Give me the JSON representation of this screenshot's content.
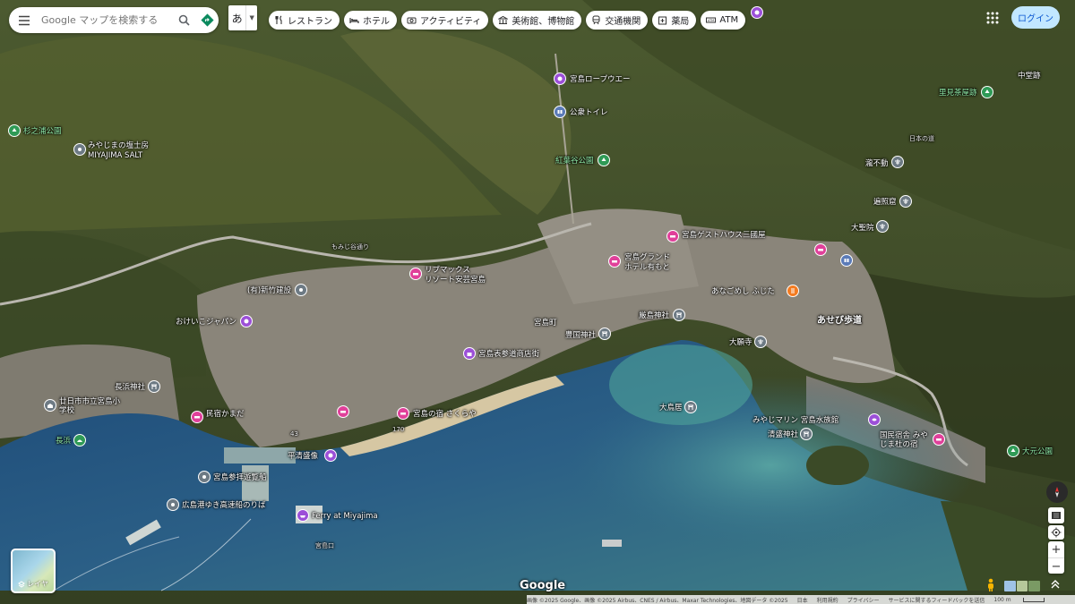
{
  "search": {
    "placeholder": "Google マップを検索する"
  },
  "ime": {
    "char": "あ"
  },
  "chips": [
    {
      "icon": "restaurant-icon",
      "label": "レストラン"
    },
    {
      "icon": "hotel-icon",
      "label": "ホテル"
    },
    {
      "icon": "camera-icon",
      "label": "アクティビティ"
    },
    {
      "icon": "museum-icon",
      "label": "美術館、博物館"
    },
    {
      "icon": "transit-icon",
      "label": "交通機関"
    },
    {
      "icon": "pharmacy-icon",
      "label": "薬局"
    },
    {
      "icon": "atm-icon",
      "label": "ATM"
    }
  ],
  "login_label": "ログイン",
  "places": [
    {
      "name": "宮島ロープウエー",
      "pin": "purple"
    },
    {
      "name": "公衆トイレ",
      "pin": "blue"
    },
    {
      "name": "紅葉谷公園",
      "pin": "green"
    },
    {
      "name": "中堂跡",
      "pin": "none"
    },
    {
      "name": "里見茶屋跡",
      "pin": "green"
    },
    {
      "name": "杉之浦公園",
      "pin": "green"
    },
    {
      "name": "みやじまの塩士房",
      "pin": "gray"
    },
    {
      "name": "MIYAJIMA SALT",
      "pin": "none"
    },
    {
      "name": "瀧不動",
      "pin": "gray"
    },
    {
      "name": "遍照窟",
      "pin": "gray"
    },
    {
      "name": "大聖院",
      "pin": "gray"
    },
    {
      "name": "宮島ゲストハウス三國屋",
      "pin": "pink"
    },
    {
      "name": "宮島グランド",
      "pin": "pink"
    },
    {
      "name": "ホテル有もと",
      "pin": "none"
    },
    {
      "name": "リブマックス",
      "pin": "pink"
    },
    {
      "name": "リゾート安芸宮島",
      "pin": "none"
    },
    {
      "name": "(有)新竹建設",
      "pin": "gray"
    },
    {
      "name": "おけいこジャパン",
      "pin": "purple"
    },
    {
      "name": "宮島町",
      "pin": "none"
    },
    {
      "name": "豊国神社",
      "pin": "gray"
    },
    {
      "name": "厳島神社",
      "pin": "gray"
    },
    {
      "name": "あなごめし ふじた",
      "pin": "orange"
    },
    {
      "name": "大願寺",
      "pin": "gray"
    },
    {
      "name": "あせび歩道",
      "pin": "none"
    },
    {
      "name": "宮島表参道商店街",
      "pin": "purple"
    },
    {
      "name": "長浜神社",
      "pin": "gray"
    },
    {
      "name": "廿日市市立宮島小学校",
      "pin": "gray"
    },
    {
      "name": "長浜",
      "pin": "green"
    },
    {
      "name": "民宿かまだ",
      "pin": "pink"
    },
    {
      "name": "宮島の宿 さくらや",
      "pin": "pink"
    },
    {
      "name": "大鳥居",
      "pin": "gray"
    },
    {
      "name": "みやじマリン 宮島水族館",
      "pin": "purple"
    },
    {
      "name": "清盛神社",
      "pin": "gray"
    },
    {
      "name": "国民宿舎 みやじま杜の宿",
      "pin": "pink"
    },
    {
      "name": "大元公園",
      "pin": "green"
    },
    {
      "name": "平清盛像",
      "pin": "purple"
    },
    {
      "name": "宮島参拝遊覧船",
      "pin": "gray"
    },
    {
      "name": "広島港ゆき高速船のりば",
      "pin": "gray"
    },
    {
      "name": "Ferry at Miyajima",
      "pin": "purple"
    }
  ],
  "road_labels": [
    "もみじ谷通り",
    "日本の道",
    "43",
    "170",
    "宮島口"
  ],
  "layers_label": "レイヤ",
  "google_logo": "Google",
  "footer": {
    "attribution": "画像 ©2025 Google、画像 ©2025 Airbus、CNES / Airbus、Maxar Technologies、地図データ ©2025",
    "links": [
      "日本",
      "利用規約",
      "プライバシー",
      "サービスに関するフィードバックを送信"
    ],
    "scale": "100 m"
  }
}
